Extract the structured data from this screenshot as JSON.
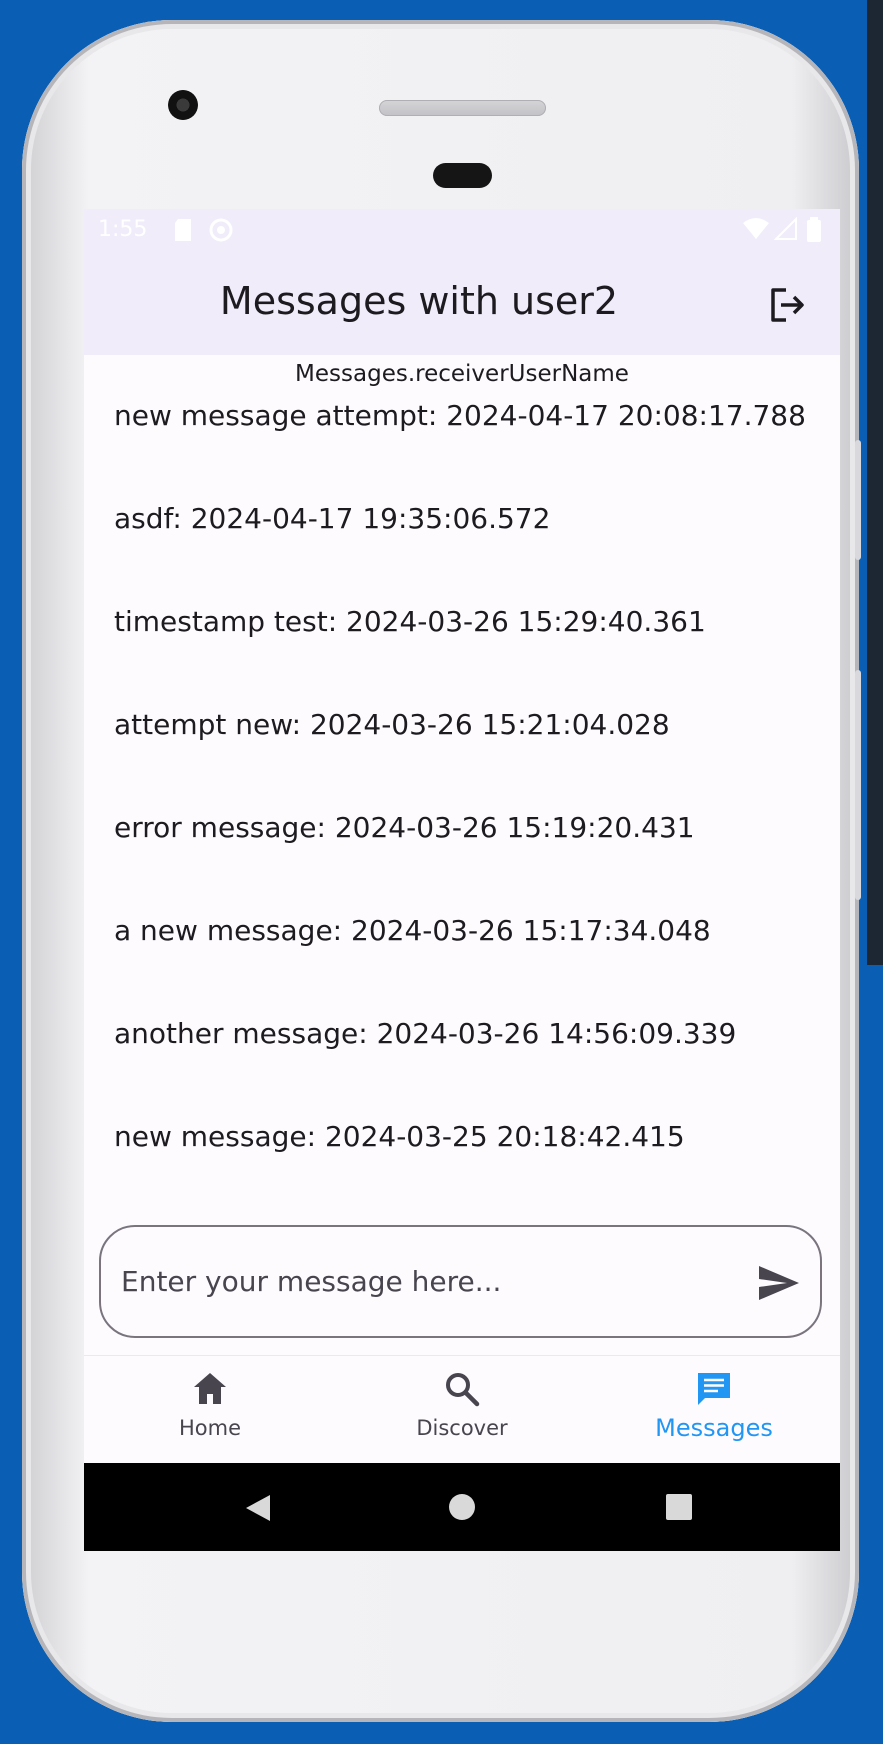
{
  "status_bar": {
    "time": "1:55"
  },
  "app_bar": {
    "title": "Messages with user2",
    "logout_icon": "logout-icon"
  },
  "subtitle": "Messages.receiverUserName",
  "messages": [
    "new message attempt: 2024-04-17 20:08:17.788",
    "asdf: 2024-04-17 19:35:06.572",
    "timestamp test: 2024-03-26 15:29:40.361",
    "attempt new: 2024-03-26 15:21:04.028",
    "error message: 2024-03-26 15:19:20.431",
    "a new message: 2024-03-26 15:17:34.048",
    "another message: 2024-03-26 14:56:09.339",
    "new message: 2024-03-25 20:18:42.415"
  ],
  "composer": {
    "placeholder": "Enter your message here...",
    "send_icon": "send-icon"
  },
  "bottom_nav": [
    {
      "label": "Home",
      "icon": "home-icon",
      "active": false
    },
    {
      "label": "Discover",
      "icon": "search-icon",
      "active": false
    },
    {
      "label": "Messages",
      "icon": "chat-icon",
      "active": true
    }
  ],
  "colors": {
    "accent": "#2196f3",
    "app_bar_bg": "#f0ecfa",
    "background": "#0a5fb4"
  }
}
